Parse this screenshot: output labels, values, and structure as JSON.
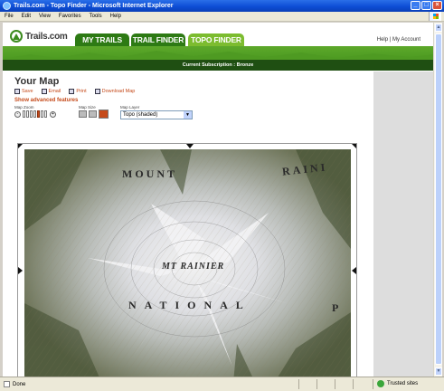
{
  "window": {
    "title": "Trails.com - Topo Finder - Microsoft Internet Explorer",
    "controls": [
      "_",
      "□",
      "×"
    ]
  },
  "menu": [
    "File",
    "Edit",
    "View",
    "Favorites",
    "Tools",
    "Help"
  ],
  "site": {
    "logo_text": "Trails.com",
    "tabs": [
      {
        "label": "MY TRAILS",
        "active": false
      },
      {
        "label": "TRAIL FINDER",
        "active": false
      },
      {
        "label": "TOPO FINDER",
        "active": true
      }
    ],
    "account_links": "Help | My Account",
    "subscription": "Current Subscription : Bronze",
    "brand_green": "#3f8f1b",
    "accent_orange": "#c54a1a"
  },
  "map_page": {
    "title": "Your Map",
    "actions": [
      {
        "label": "Save",
        "icon": "save-icon"
      },
      {
        "label": "Email",
        "icon": "email-icon"
      },
      {
        "label": "Print",
        "icon": "print-icon"
      },
      {
        "label": "Download Map",
        "icon": "download-icon"
      }
    ],
    "advanced_link": "Show advanced features",
    "zoom_label": "Map Zoom",
    "size_label": "Map Size",
    "layer_label": "Map Layer",
    "layer_value": "Topo (shaded)",
    "zoom_level": 5,
    "zoom_steps": 7,
    "size_selected": 3
  },
  "map_labels": {
    "mount": "MOUNT",
    "rainier_top": "RAINI",
    "peak": "MT RAINIER",
    "national": "NATIONAL",
    "park_end": "P"
  },
  "status": {
    "left": "Done",
    "zone": "Trusted sites"
  }
}
